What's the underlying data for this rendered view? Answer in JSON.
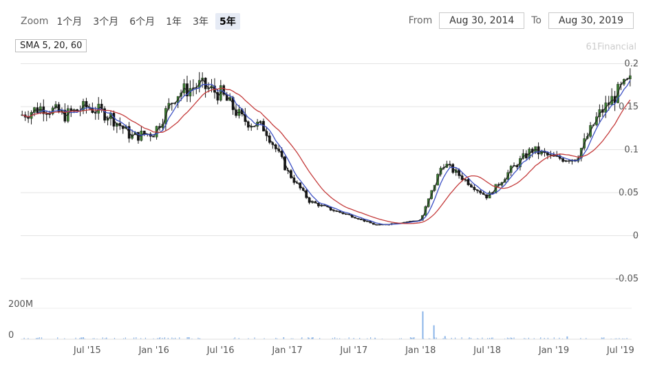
{
  "zoom": {
    "label": "Zoom",
    "buttons": [
      "1个月",
      "3个月",
      "6个月",
      "1年",
      "3年",
      "5年"
    ],
    "active": "5年"
  },
  "range": {
    "from_label": "From",
    "from_value": "Aug 30, 2014",
    "to_label": "To",
    "to_value": "Aug 30, 2019"
  },
  "indicator_label": "SMA 5, 20, 60",
  "credit": "61Financial",
  "colors": {
    "candle_up": "#3a7d2f",
    "candle_down": "#111111",
    "sma_short": "#222222",
    "sma_mid": "#3b4fc4",
    "sma_long": "#c43a3a",
    "volume": "#8ab4e8"
  },
  "chart_data": [
    {
      "type": "line",
      "subtype": "candlestick",
      "title": "",
      "xlabel": "",
      "ylabel": "",
      "x_ticks": [
        "Jul '15",
        "Jan '16",
        "Jul '16",
        "Jan '17",
        "Jul '17",
        "Jan '18",
        "Jul '18",
        "Jan '19",
        "Jul '19"
      ],
      "y_ticks": [
        "-0.05",
        "0",
        "0.05",
        "0.1",
        "0.15",
        "0.2"
      ],
      "x_range": [
        "2015-01",
        "2019-08"
      ],
      "ylim": [
        -0.05,
        0.21
      ],
      "grid": true,
      "series": [
        {
          "name": "SMA 5, 20, 60",
          "x": [
            "2015-01",
            "2015-03",
            "2015-05",
            "2015-07",
            "2015-09",
            "2015-11",
            "2016-01",
            "2016-03",
            "2016-05",
            "2016-07",
            "2016-09",
            "2016-11",
            "2017-01",
            "2017-03",
            "2017-05",
            "2017-07",
            "2017-09",
            "2017-11",
            "2018-01",
            "2018-03",
            "2018-05",
            "2018-07",
            "2018-09",
            "2018-11",
            "2019-01",
            "2019-03",
            "2019-05",
            "2019-07",
            "2019-08"
          ],
          "values": [
            0.14,
            0.15,
            0.14,
            0.15,
            0.14,
            0.115,
            0.12,
            0.165,
            0.175,
            0.165,
            0.135,
            0.125,
            0.075,
            0.04,
            0.03,
            0.022,
            0.012,
            0.015,
            0.018,
            0.085,
            0.065,
            0.045,
            0.075,
            0.1,
            0.09,
            0.09,
            0.14,
            0.17,
            0.18
          ]
        }
      ]
    },
    {
      "type": "bar",
      "title": "",
      "name": "volume",
      "y_ticks": [
        "0",
        "200M"
      ],
      "ylim": [
        0,
        200
      ],
      "x": [
        "2017-06",
        "2017-12",
        "2018-01",
        "2018-02",
        "2018-03",
        "2018-06",
        "2018-09",
        "2019-02",
        "2019-07"
      ],
      "values": [
        3,
        10,
        180,
        90,
        20,
        4,
        8,
        18,
        5
      ]
    }
  ]
}
